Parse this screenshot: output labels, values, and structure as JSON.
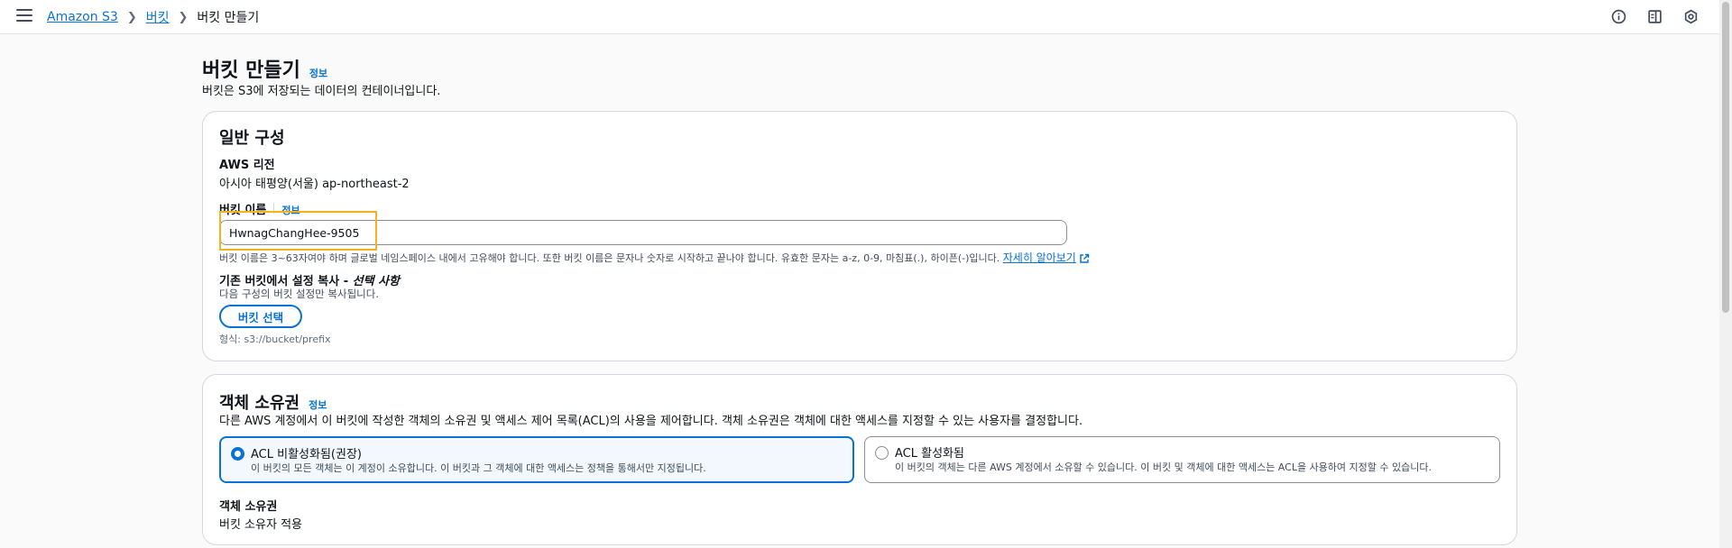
{
  "breadcrumb": {
    "items": [
      "Amazon S3",
      "버킷"
    ],
    "current": "버킷 만들기"
  },
  "header": {
    "title": "버킷 만들기",
    "info": "정보",
    "description": "버킷은 S3에 저장되는 데이터의 컨테이너입니다."
  },
  "general": {
    "heading": "일반 구성",
    "region_label": "AWS 리전",
    "region_value": "아시아 태평양(서울) ap-northeast-2",
    "bucket_name_label": "버킷 이름",
    "info": "정보",
    "bucket_name_value": "HwnagChangHee-9505",
    "bucket_name_hint": "버킷 이름은 3~63자여야 하며 글로벌 네임스페이스 내에서 고유해야 합니다. 또한 버킷 이름은 문자나 숫자로 시작하고 끝나야 합니다. 유효한 문자는 a-z, 0-9, 마침표(.), 하이픈(-)입니다.",
    "learn_more": "자세히 알아보기",
    "copy_label": "기존 버킷에서 설정 복사 - ",
    "copy_optional": "선택 사항",
    "copy_desc": "다음 구성의 버킷 설정만 복사됩니다.",
    "choose_bucket_button": "버킷 선택",
    "format_hint": "형식: s3://bucket/prefix"
  },
  "ownership": {
    "heading": "객체 소유권",
    "info": "정보",
    "description": "다른 AWS 계정에서 이 버킷에 작성한 객체의 소유권 및 액세스 제어 목록(ACL)의 사용을 제어합니다. 객체 소유권은 객체에 대한 액세스를 지정할 수 있는 사용자를 결정합니다.",
    "options": [
      {
        "title": "ACL 비활성화됨(권장)",
        "desc": "이 버킷의 모든 객체는 이 계정이 소유합니다. 이 버킷과 그 객체에 대한 액세스는 정책을 통해서만 지정됩니다.",
        "selected": true
      },
      {
        "title": "ACL 활성화됨",
        "desc": "이 버킷의 객체는 다른 AWS 계정에서 소유할 수 있습니다. 이 버킷 및 객체에 대한 액세스는 ACL을 사용하여 지정할 수 있습니다.",
        "selected": false
      }
    ],
    "owner_label": "객체 소유권",
    "owner_value": "버킷 소유자 적용"
  },
  "icons": [
    "menu-icon",
    "info-circle-icon",
    "notifications-panel-icon",
    "settings-hex-icon",
    "external-link-icon"
  ],
  "colors": {
    "link": "#0972d3",
    "highlight": "#f2b31c",
    "border": "#d5d9df"
  }
}
